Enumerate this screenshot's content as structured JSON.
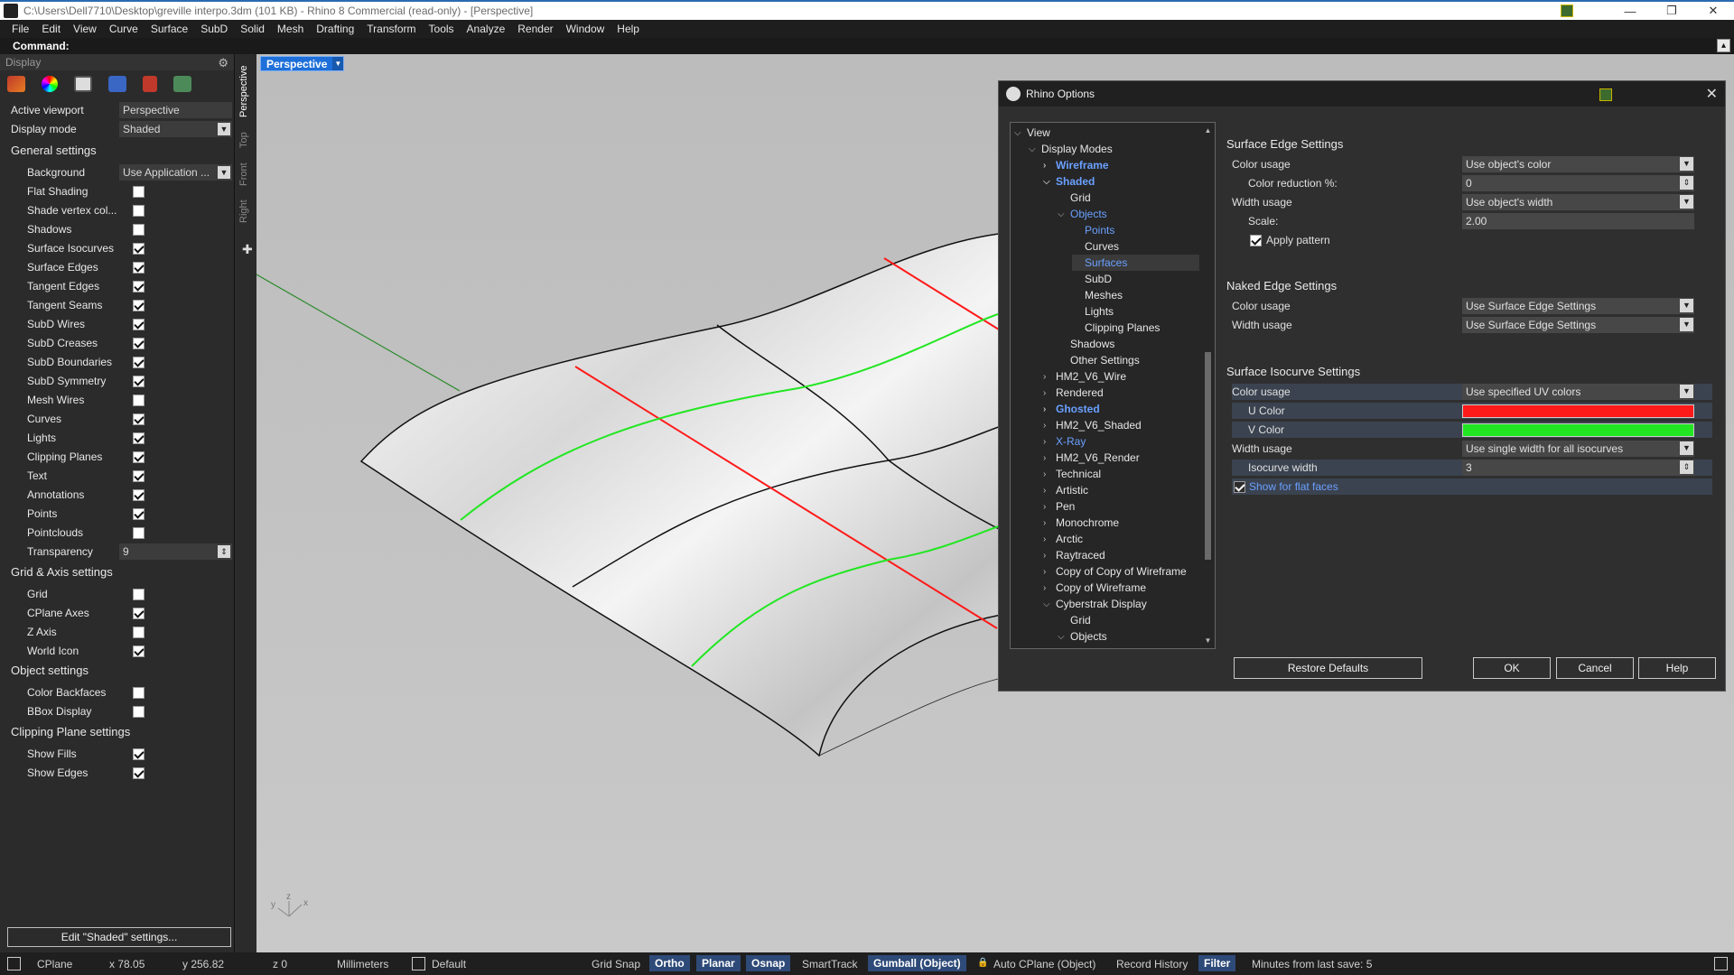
{
  "window": {
    "title": "C:\\Users\\Dell7710\\Desktop\\greville interpo.3dm (101 KB) - Rhino 8 Commercial (read-only) - [Perspective]",
    "buttons": [
      "—",
      "❐",
      "✕"
    ]
  },
  "menu": [
    "File",
    "Edit",
    "View",
    "Curve",
    "Surface",
    "SubD",
    "Solid",
    "Mesh",
    "Drafting",
    "Transform",
    "Tools",
    "Analyze",
    "Render",
    "Window",
    "Help"
  ],
  "command": {
    "label": "Command:"
  },
  "display_panel": {
    "title": "Display",
    "active_viewport_label": "Active viewport",
    "active_viewport_value": "Perspective",
    "display_mode_label": "Display mode",
    "display_mode_value": "Shaded",
    "general_settings": "General settings",
    "background_label": "Background",
    "background_value": "Use Application ...",
    "general_items": [
      {
        "label": "Flat Shading",
        "checked": false
      },
      {
        "label": "Shade vertex col...",
        "checked": false
      },
      {
        "label": "Shadows",
        "checked": false
      },
      {
        "label": "Surface Isocurves",
        "checked": true
      },
      {
        "label": "Surface Edges",
        "checked": true
      },
      {
        "label": "Tangent Edges",
        "checked": true
      },
      {
        "label": "Tangent Seams",
        "checked": true
      },
      {
        "label": "SubD Wires",
        "checked": true
      },
      {
        "label": "SubD Creases",
        "checked": true
      },
      {
        "label": "SubD Boundaries",
        "checked": true
      },
      {
        "label": "SubD Symmetry",
        "checked": true
      },
      {
        "label": "Mesh Wires",
        "checked": false
      },
      {
        "label": "Curves",
        "checked": true
      },
      {
        "label": "Lights",
        "checked": true
      },
      {
        "label": "Clipping Planes",
        "checked": true
      },
      {
        "label": "Text",
        "checked": true
      },
      {
        "label": "Annotations",
        "checked": true
      },
      {
        "label": "Points",
        "checked": true
      },
      {
        "label": "Pointclouds",
        "checked": false
      }
    ],
    "transparency_label": "Transparency",
    "transparency_value": "9",
    "grid_axis_settings": "Grid & Axis settings",
    "grid_items": [
      {
        "label": "Grid",
        "checked": false
      },
      {
        "label": "CPlane Axes",
        "checked": true
      },
      {
        "label": "Z Axis",
        "checked": false
      },
      {
        "label": "World Icon",
        "checked": true
      }
    ],
    "object_settings": "Object settings",
    "object_items": [
      {
        "label": "Color Backfaces",
        "checked": false
      },
      {
        "label": "BBox Display",
        "checked": false
      }
    ],
    "clipping_settings": "Clipping Plane settings",
    "clipping_items": [
      {
        "label": "Show Fills",
        "checked": true
      },
      {
        "label": "Show Edges",
        "checked": true
      }
    ],
    "edit_button": "Edit \"Shaded\" settings..."
  },
  "viewport_tabs": [
    "Perspective",
    "Top",
    "Front",
    "Right"
  ],
  "viewport": {
    "tab_label": "Perspective",
    "axis_labels": {
      "z": "z",
      "y": "y",
      "x": "x"
    }
  },
  "dialog": {
    "title": "Rhino Options",
    "tree": [
      {
        "label": "View",
        "chevron": "down"
      },
      {
        "label": "Display Modes",
        "chevron": "down"
      },
      {
        "label": "Wireframe",
        "chevron": "right",
        "style": "link-bold"
      },
      {
        "label": "Shaded",
        "chevron": "down",
        "style": "link-bold"
      },
      {
        "label": "Grid",
        "chevron": ""
      },
      {
        "label": "Objects",
        "chevron": "down",
        "style": "link"
      },
      {
        "label": "Points",
        "chevron": "",
        "style": "link"
      },
      {
        "label": "Curves",
        "chevron": ""
      },
      {
        "label": "Surfaces",
        "chevron": "",
        "style": "link",
        "selected": true
      },
      {
        "label": "SubD",
        "chevron": ""
      },
      {
        "label": "Meshes",
        "chevron": ""
      },
      {
        "label": "Lights",
        "chevron": ""
      },
      {
        "label": "Clipping Planes",
        "chevron": ""
      },
      {
        "label": "Shadows",
        "chevron": ""
      },
      {
        "label": "Other Settings",
        "chevron": ""
      },
      {
        "label": "HM2_V6_Wire",
        "chevron": "right"
      },
      {
        "label": "Rendered",
        "chevron": "right"
      },
      {
        "label": "Ghosted",
        "chevron": "right",
        "style": "link-bold"
      },
      {
        "label": "HM2_V6_Shaded",
        "chevron": "right"
      },
      {
        "label": "X-Ray",
        "chevron": "right",
        "style": "link"
      },
      {
        "label": "HM2_V6_Render",
        "chevron": "right"
      },
      {
        "label": "Technical",
        "chevron": "right"
      },
      {
        "label": "Artistic",
        "chevron": "right"
      },
      {
        "label": "Pen",
        "chevron": "right"
      },
      {
        "label": "Monochrome",
        "chevron": "right"
      },
      {
        "label": "Arctic",
        "chevron": "right"
      },
      {
        "label": "Raytraced",
        "chevron": "right"
      },
      {
        "label": "Copy of Copy of Wireframe",
        "chevron": "right"
      },
      {
        "label": "Copy of Wireframe",
        "chevron": "right"
      },
      {
        "label": "Cyberstrak Display",
        "chevron": "down"
      },
      {
        "label": "Grid",
        "chevron": ""
      },
      {
        "label": "Objects",
        "chevron": "down"
      }
    ],
    "surface_edge": {
      "title": "Surface Edge Settings",
      "color_usage_label": "Color usage",
      "color_usage_value": "Use object's color",
      "color_reduction_label": "Color reduction %:",
      "color_reduction_value": "0",
      "width_usage_label": "Width usage",
      "width_usage_value": "Use object's width",
      "scale_label": "Scale:",
      "scale_value": "2.00",
      "apply_pattern_label": "Apply pattern",
      "apply_pattern_checked": true
    },
    "naked_edge": {
      "title": "Naked Edge Settings",
      "color_usage_label": "Color usage",
      "color_usage_value": "Use Surface Edge Settings",
      "width_usage_label": "Width usage",
      "width_usage_value": "Use Surface Edge Settings"
    },
    "isocurve": {
      "title": "Surface Isocurve Settings",
      "color_usage_label": "Color usage",
      "color_usage_value": "Use specified UV colors",
      "u_color_label": "U Color",
      "u_color": "#ff1a1a",
      "v_color_label": "V Color",
      "v_color": "#22e622",
      "width_usage_label": "Width usage",
      "width_usage_value": "Use single width for all isocurves",
      "isocurve_width_label": "Isocurve width",
      "isocurve_width_value": "3",
      "show_flat_label": "Show for flat faces",
      "show_flat_checked": true
    },
    "buttons": {
      "restore": "Restore Defaults",
      "ok": "OK",
      "cancel": "Cancel",
      "help": "Help"
    }
  },
  "statusbar": {
    "cplane": "CPlane",
    "x": "x 78.05",
    "y": "y 256.82",
    "z": "z 0",
    "units": "Millimeters",
    "layer": "Default",
    "grid_snap": "Grid Snap",
    "ortho": "Ortho",
    "planar": "Planar",
    "osnap": "Osnap",
    "smarttrack": "SmartTrack",
    "gumball": "Gumball (Object)",
    "auto_cplane": "Auto CPlane (Object)",
    "record_history": "Record History",
    "filter": "Filter",
    "minutes": "Minutes from last save: 5"
  },
  "colors": {
    "accent": "#1e6fd9",
    "isocurve_u": "#ff1a1a",
    "isocurve_v": "#22e622"
  }
}
